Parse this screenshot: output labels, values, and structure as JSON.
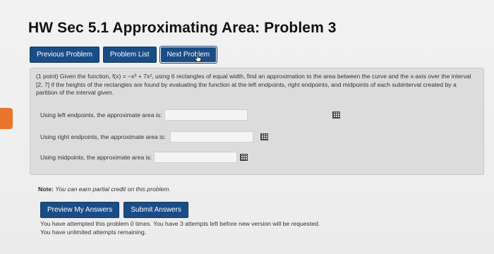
{
  "header": {
    "title": "HW Sec 5.1 Approximating Area: Problem 3"
  },
  "nav": {
    "previous": "Previous Problem",
    "list": "Problem List",
    "next": "Next Problem"
  },
  "problem": {
    "statement": "(1 point) Given the function, f(x) = −x³ + 7x², using 6 rectangles of equal width, find an approximation to the area between the curve and the x-axis over the interval [2, 7] if the heights of the rectangles are found by evaluating the function at the left endpoints, right endpoints, and midpoints of each subinterval created by a partition of the interval given.",
    "fields": [
      {
        "label": "Using left endpoints, the approximate area is:",
        "value": ""
      },
      {
        "label": "Using right endpoints, the approximate area is:",
        "value": ""
      },
      {
        "label": "Using midpoints, the approximate area is:",
        "value": ""
      }
    ]
  },
  "note": {
    "label": "Note:",
    "text": "You can earn partial credit on this problem."
  },
  "actions": {
    "preview": "Preview My Answers",
    "submit": "Submit Answers"
  },
  "status": {
    "attempts_line": "You have attempted this problem 0 times. You have 3 attempts left before new version will be requested.",
    "unlimited_line": "You have unlimited attempts remaining."
  },
  "colors": {
    "button": "#1a4d86",
    "accent_tab": "#e8752a"
  },
  "icons": {
    "cursor": "pointer-cursor-icon",
    "equation_editor": "grid-icon"
  }
}
